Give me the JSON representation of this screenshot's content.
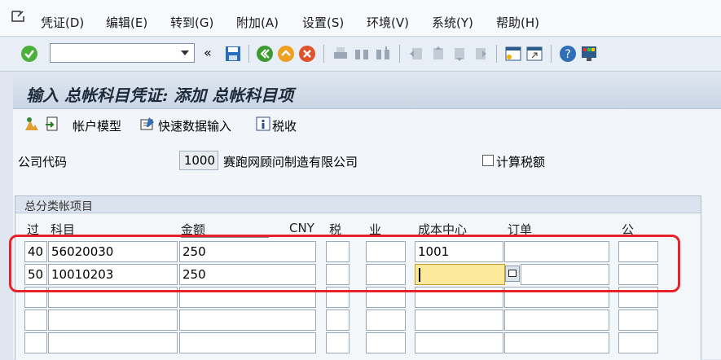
{
  "menu": [
    "凭证(D)",
    "编辑(E)",
    "转到(G)",
    "附加(A)",
    "设置(S)",
    "环境(V)",
    "系统(Y)",
    "帮助(H)"
  ],
  "toolbar": {
    "command_value": "",
    "icons": [
      "enter-icon",
      "back-double-icon",
      "save-icon",
      "back-icon",
      "exit-icon",
      "cancel-icon",
      "print-icon",
      "find-icon",
      "find-next-icon",
      "first-page-icon",
      "prev-page-icon",
      "next-page-icon",
      "last-page-icon",
      "new-session-icon",
      "shortcut-icon",
      "help-icon",
      "layout-icon"
    ]
  },
  "title": "输入 总帐科目凭证: 添加 总帐科目项",
  "app_toolbar": {
    "account_model": "帐户模型",
    "fast_entry": "快速数据输入",
    "tax": "税收"
  },
  "header": {
    "company_code_label": "公司代码",
    "company_code": "1000",
    "company_name": "赛跑网顾问制造有限公司",
    "calc_tax_label": "计算税额",
    "calc_tax_checked": false
  },
  "items": {
    "title": "总分类帐项目",
    "columns": [
      "过",
      "科目",
      "金额",
      "CNY",
      "税",
      "业",
      "成本中心",
      "订单",
      "公"
    ],
    "rows": [
      {
        "pk": "40",
        "account": "56020030",
        "amount": "250",
        "tax": "",
        "ba": "",
        "cost_center": "1001",
        "order": "",
        "co": ""
      },
      {
        "pk": "50",
        "account": "10010203",
        "amount": "250",
        "tax": "",
        "ba": "",
        "cost_center": "",
        "order": "",
        "co": ""
      },
      {
        "pk": "",
        "account": "",
        "amount": "",
        "tax": "",
        "ba": "",
        "cost_center": "",
        "order": "",
        "co": ""
      },
      {
        "pk": "",
        "account": "",
        "amount": "",
        "tax": "",
        "ba": "",
        "cost_center": "",
        "order": "",
        "co": ""
      },
      {
        "pk": "",
        "account": "",
        "amount": "",
        "tax": "",
        "ba": "",
        "cost_center": "",
        "order": "",
        "co": ""
      }
    ]
  }
}
